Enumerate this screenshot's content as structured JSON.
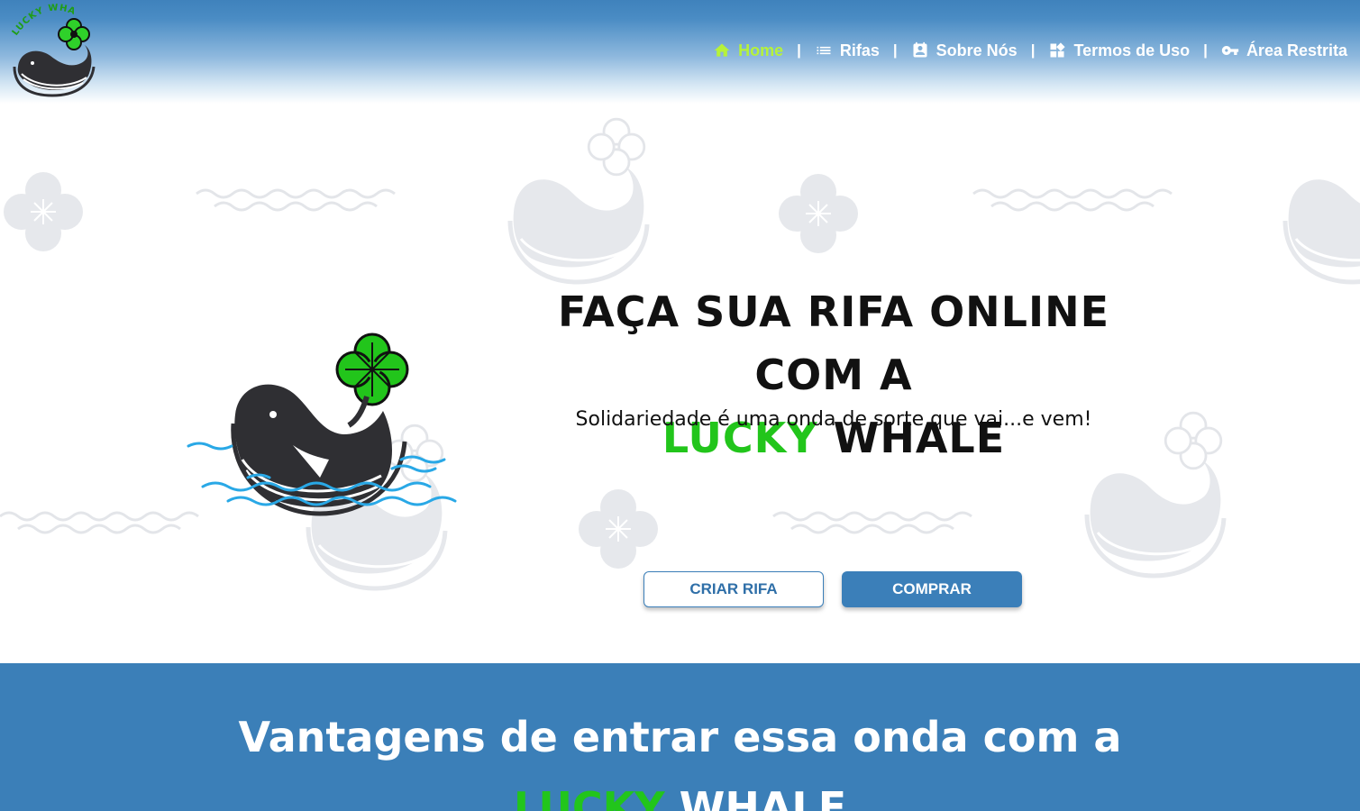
{
  "brand": {
    "logo_text": "LUCKY WHALE"
  },
  "nav": {
    "items": [
      {
        "label": "Home",
        "icon": "home-icon",
        "active": true
      },
      {
        "label": "Rifas",
        "icon": "list-icon",
        "active": false
      },
      {
        "label": "Sobre Nós",
        "icon": "contact-card-icon",
        "active": false
      },
      {
        "label": "Termos de Uso",
        "icon": "widgets-icon",
        "active": false
      },
      {
        "label": "Área Restrita",
        "icon": "key-icon",
        "active": false
      }
    ],
    "separator": "|"
  },
  "hero": {
    "title_line1": "FAÇA SUA RIFA ONLINE COM A",
    "title_highlight": "LUCKY",
    "title_rest": "WHALE",
    "subtitle": "Solidariedade é uma onda de sorte que vai...e vem!",
    "buttons": {
      "create": "CRIAR RIFA",
      "buy": "COMPRAR"
    }
  },
  "advantages": {
    "title_line1": "Vantagens de entrar essa onda com a",
    "title_highlight": "LUCKY",
    "title_rest": "WHALE"
  },
  "colors": {
    "primary_blue": "#3b7fb9",
    "active_nav": "#b6f23a",
    "lucky_green": "#22c51b",
    "wave_blue": "#29a8e6"
  }
}
